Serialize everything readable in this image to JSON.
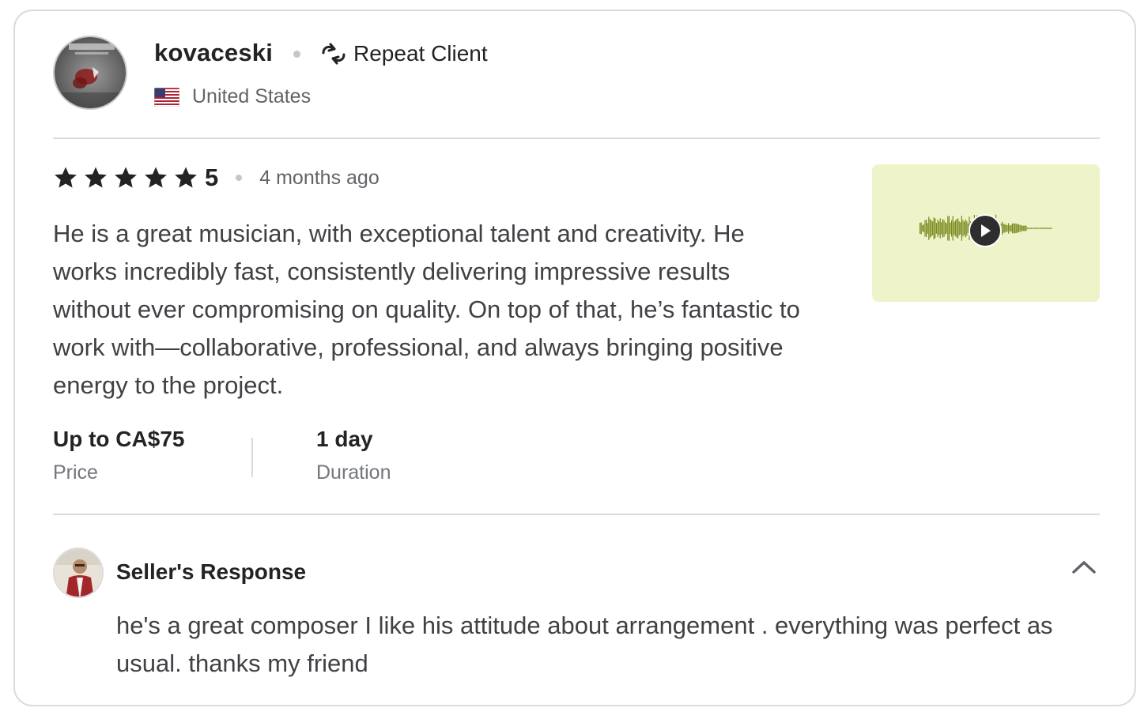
{
  "reviewer": {
    "username": "kovaceski",
    "repeat_label": "Repeat Client",
    "country": "United States",
    "avatar_icon": "album-cover-avatar",
    "flag_icon": "us-flag-icon"
  },
  "review": {
    "rating": "5",
    "stars_filled": 5,
    "time_ago": "4 months ago",
    "text": "He is a great musician, with exceptional talent and creativity. He works incredibly fast, consistently delivering impressive results without ever compromising on quality. On top of that, he’s fantastic to work with—collaborative, professional, and always bringing positive energy to the project."
  },
  "audio_sample": {
    "background_color": "#eff3c9",
    "waveform_color": "#7a8a1e",
    "play_icon": "play-icon"
  },
  "meta": {
    "price_value": "Up to CA$75",
    "price_label": "Price",
    "duration_value": "1 day",
    "duration_label": "Duration"
  },
  "seller_response": {
    "title": "Seller's Response",
    "text": "he's a great composer I like his attitude about arrangement . everything was perfect as usual. thanks my friend",
    "collapse_icon": "chevron-up-icon"
  },
  "colors": {
    "text_primary": "#222325",
    "text_secondary": "#62646a",
    "divider": "#dadbdd",
    "star": "#222325"
  }
}
